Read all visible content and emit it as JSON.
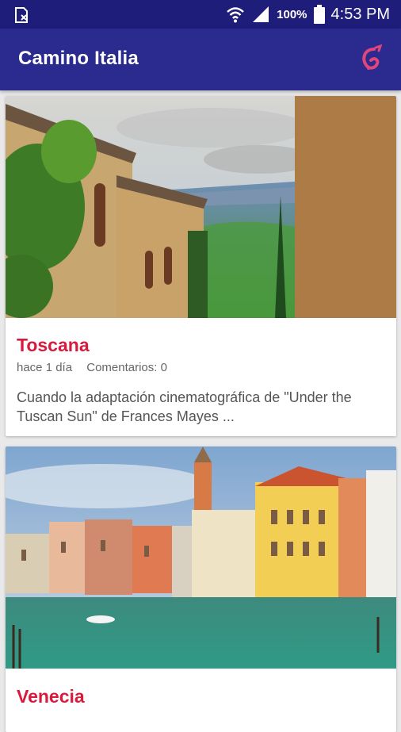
{
  "status_bar": {
    "battery_pct": "100%",
    "time": "4:53 PM",
    "icons": [
      "sd-card-icon",
      "wifi-icon",
      "signal-icon",
      "battery-icon"
    ]
  },
  "app_bar": {
    "title": "Camino Italia",
    "logo_icon": "italy-logo-icon",
    "colors": {
      "status_bar": "#1f1d7a",
      "app_bar": "#2b2a8f",
      "accent": "#d81b3c"
    }
  },
  "posts": [
    {
      "title": "Toscana",
      "time_ago": "hace 1 día",
      "comments": "Comentarios: 0",
      "excerpt": "Cuando la adaptación cinematográfica de \"Under the Tuscan Sun\" de Frances Mayes ...",
      "image": "tuscany-village-photo"
    },
    {
      "title": "Venecia",
      "image": "venice-canal-photo"
    }
  ]
}
